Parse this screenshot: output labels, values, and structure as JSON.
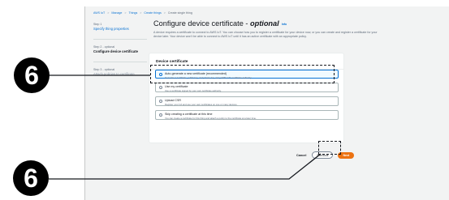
{
  "breadcrumb": {
    "items": [
      "AWS IoT",
      "Manage",
      "Things",
      "Create things",
      "Create single thing"
    ],
    "separator": ">"
  },
  "steps": [
    {
      "num": "Step 1",
      "title": "Specify thing properties"
    },
    {
      "num": "Step 2 - optional",
      "title": "Configure device certificate"
    },
    {
      "num": "Step 3 - optional",
      "title": "Attach policies to certificate"
    }
  ],
  "page": {
    "title": "Configure device certificate - ",
    "title_optional": "optional",
    "info": "Info",
    "description": "A device requires a certificate to connect to AWS IoT. You can choose how you to register a certificate for your device now, or you can create and register a certificate for your device later. Your device won't be able to connect to AWS IoT until it has an active certificate with an appropriate policy."
  },
  "card": {
    "header": "Device certificate",
    "options": [
      {
        "label": "Auto-generate a new certificate (recommended)",
        "desc": "Generate a certificate, public key, and private key using AWS IoT's certificate authority."
      },
      {
        "label": "Use my certificate",
        "desc": "Use a certificate signed by your own certificate authority."
      },
      {
        "label": "Upload CSR",
        "desc": "Register your CA and use your own certificates on one or many devices."
      },
      {
        "label": "Skip creating a certificate at this time",
        "desc": "You can create a certificate for this thing and attach a policy to the certificate at a later time."
      }
    ]
  },
  "actions": {
    "cancel": "Cancel",
    "previous": "Previous",
    "next": "Next"
  },
  "callouts": {
    "top": "6",
    "bottom": "6"
  },
  "colors": {
    "accent": "#0972d3",
    "primary_button": "#ec7211",
    "callout": "#000000"
  }
}
